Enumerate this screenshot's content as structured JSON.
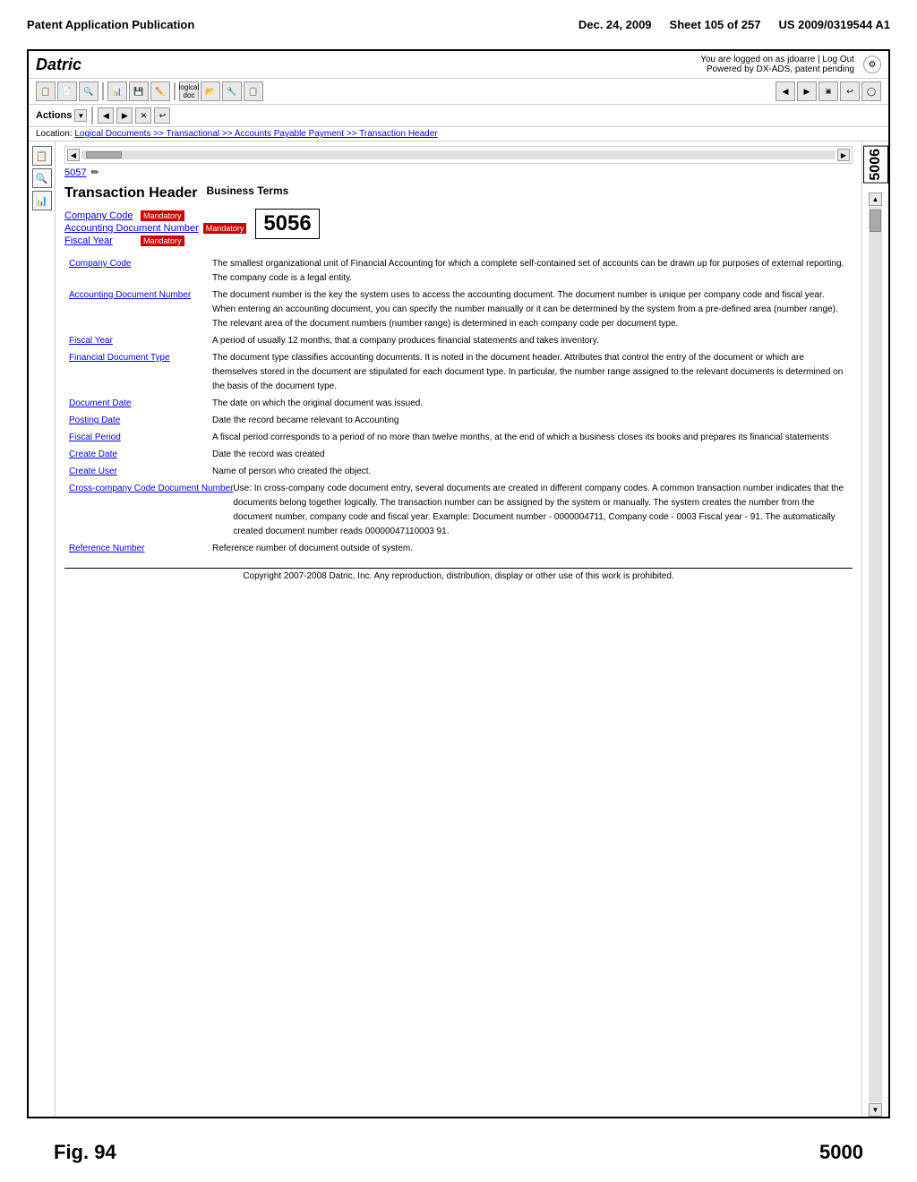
{
  "patent": {
    "publication": "Patent Application Publication",
    "date": "Dec. 24, 2009",
    "sheet": "Sheet 105 of 257",
    "number": "US 2009/0319544 A1"
  },
  "app": {
    "logo": "Datric",
    "user_info": "You are logged on as jdoarre | Log Out",
    "powered_by": "Powered by DX-ADS, patent pending",
    "settings_icon": "⚙"
  },
  "toolbar": {
    "buttons": [
      "📋",
      "📄",
      "🔍",
      "📊",
      "💾",
      "✏️",
      "📂",
      "🔧"
    ]
  },
  "actions": {
    "label": "Actions",
    "items": [
      "▼",
      "◀",
      "▶",
      "✕",
      "↩"
    ]
  },
  "location": {
    "prefix": "Location:",
    "path": "Logical Documents >> Transactional >> Accounts Payable Payment >> Transaction Header"
  },
  "right_number": "5006",
  "left_number": "5057",
  "transaction": {
    "title": "Transaction Header",
    "subtitle": "Business Terms",
    "doc_number": "5056",
    "mandatory": "Mandatory"
  },
  "fields": {
    "company_code": {
      "name": "Company Code",
      "mandatory": "Mandatory",
      "desc": "The smallest organizational unit of Financial Accounting for which a complete self-contained set of accounts can be drawn up for purposes of external reporting. The company code is a legal entity."
    },
    "accounting_doc_number": {
      "name": "Accounting Document Number",
      "mandatory": "Mandatory",
      "desc": "The document number is the key the system uses to access the accounting document. The document number is unique per company code and fiscal year. When entering an accounting document, you can specify the number manually or it can be determined by the system from a pre-defined area (number range). The relevant area of the document numbers (number range) is determined in each company code per document type."
    },
    "fiscal_year": {
      "name": "Fiscal Year",
      "mandatory": "Mandatory",
      "desc": "A period of usually 12 months, that a company produces financial statements and takes inventory."
    },
    "financial_doc_type": {
      "name": "Financial Document Type",
      "desc": "The document type classifies accounting documents. It is noted in the document header. Attributes that control the entry of the document or which are themselves stored in the document are stipulated for each document type. In particular, the number range assigned to the relevant documents is determined on the basis of the document type."
    },
    "document_date": {
      "name": "Document Date",
      "desc": "The date on which the original document was issued."
    },
    "posting_date": {
      "name": "Posting Date",
      "desc": "Date the record became relevant to Accounting"
    },
    "fiscal_period": {
      "name": "Fiscal Period",
      "desc": "A fiscal period corresponds to a period of no more than twelve months, at the end of which a business closes its books and prepares its financial statements"
    },
    "create_date": {
      "name": "Create Date",
      "desc": "Date the record was created"
    },
    "create_user": {
      "name": "Create User",
      "desc": "Name of person who created the object."
    },
    "cross_company_doc_number": {
      "name": "Cross-company Code Document Number",
      "desc": "Use: In cross-company code document entry, several documents are created in different company codes. A common transaction number indicates that the documents belong together logically. The transaction number can be assigned by the system or manually. The system creates the number from the document number, company code and fiscal year. Example: Document number - 0000004711, Company code - 0003 Fiscal year - 91. The automatically created document number reads 00000047110003 91."
    },
    "reference_number": {
      "name": "Reference Number",
      "desc": "Reference number of document outside of system."
    }
  },
  "copyright": "Copyright 2007-2008 Datric, Inc. Any reproduction, distribution, display or other use of this work is prohibited.",
  "fig": "Fig. 94",
  "side_number_bottom": "5000",
  "scroll": {
    "up": "▲",
    "down": "▼",
    "left": "◀",
    "right": "▶"
  },
  "panel_icons": {
    "close": "✕",
    "minimize": "−",
    "settings": "⚙",
    "pencil": "✏"
  }
}
